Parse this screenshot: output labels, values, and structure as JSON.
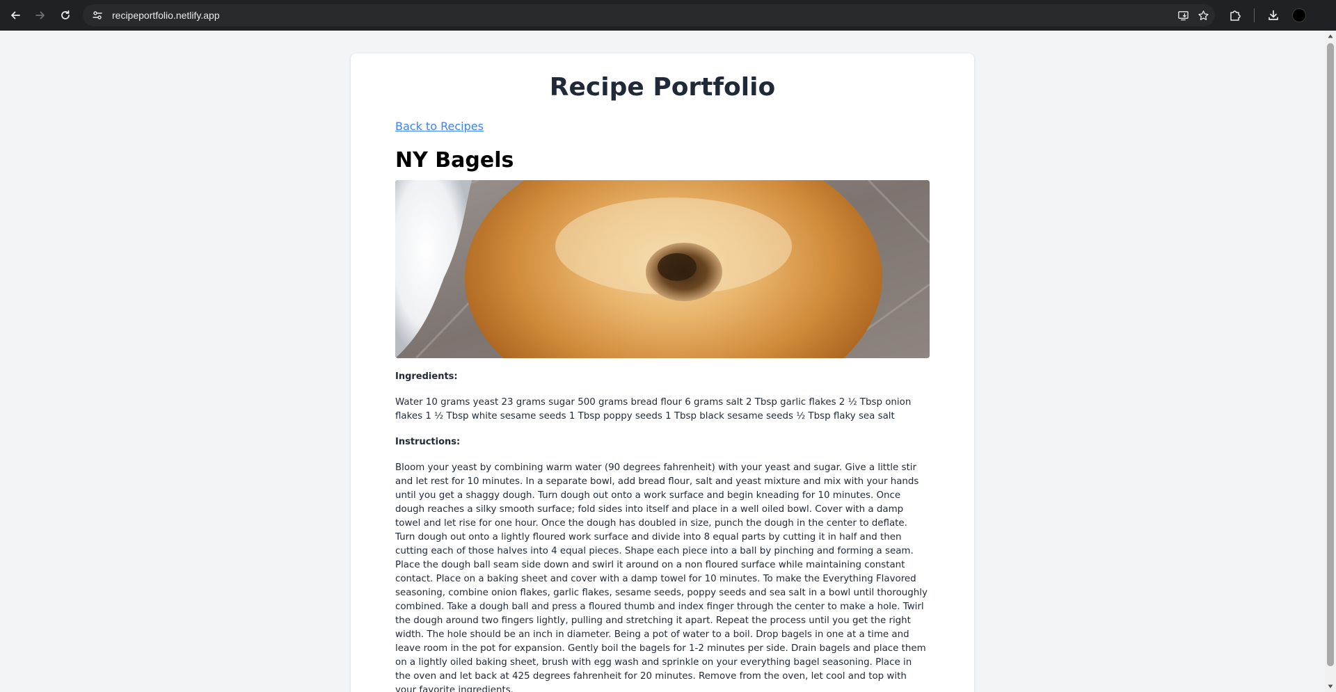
{
  "browser": {
    "url": "recipeportfolio.netlify.app",
    "icons": {
      "back": "back-arrow-icon",
      "forward": "forward-arrow-icon",
      "reload": "reload-icon",
      "site_info": "site-settings-icon",
      "install": "install-app-icon",
      "bookmark": "star-icon",
      "extensions": "puzzle-icon",
      "downloads": "download-icon",
      "profile": "profile-avatar"
    }
  },
  "page": {
    "site_title": "Recipe Portfolio",
    "back_link": "Back to Recipes",
    "recipe": {
      "title": "NY Bagels",
      "image_alt": "bagel",
      "ingredients_label": "Ingredients:",
      "ingredients_text": "Water 10 grams yeast 23 grams sugar 500 grams bread flour 6 grams salt 2 Tbsp garlic flakes 2 ½ Tbsp onion flakes 1 ½ Tbsp white sesame seeds 1 Tbsp poppy seeds 1 Tbsp black sesame seeds ½ Tbsp flaky sea salt",
      "instructions_label": "Instructions:",
      "instructions_text": "Bloom your yeast by combining warm water (90 degrees fahrenheit) with your yeast and sugar. Give a little stir and let rest for 10 minutes. In a separate bowl, add bread flour, salt and yeast mixture and mix with your hands until you get a shaggy dough. Turn dough out onto a work surface and begin kneading for 10 minutes. Once dough reaches a silky smooth surface; fold sides into itself and place in a well oiled bowl. Cover with a damp towel and let rise for one hour. Once the dough has doubled in size, punch the dough in the center to deflate. Turn dough out onto a lightly floured work surface and divide into 8 equal parts by cutting it in half and then cutting each of those halves into 4 equal pieces. Shape each piece into a ball by pinching and forming a seam. Place the dough ball seam side down and swirl it around on a non floured surface while maintaining constant contact. Place on a baking sheet and cover with a damp towel for 10 minutes. To make the Everything Flavored seasoning, combine onion flakes, garlic flakes, sesame seeds, poppy seeds and sea salt in a bowl until thoroughly combined. Take a dough ball and press a floured thumb and index finger through the center to make a hole. Twirl the dough around two fingers lightly, pulling and stretching it apart. Repeat the process until you get the right width. The hole should be an inch in diameter. Being a pot of water to a boil. Drop bagels in one at a time and leave room in the pot for expansion. Gently boil the bagels for 1-2 minutes per side. Drain bagels and place them on a lightly oiled baking sheet, brush with egg wash and sprinkle on your everything bagel seasoning. Place in the oven and let back at 425 degrees fahrenheit for 20 minutes. Remove from the oven, let cool and top with your favorite ingredients."
    }
  },
  "colors": {
    "page_bg": "#f3f4f6",
    "card_bg": "#ffffff",
    "title": "#1f2937",
    "link": "#3b82f6",
    "chrome_bg": "#202124"
  }
}
